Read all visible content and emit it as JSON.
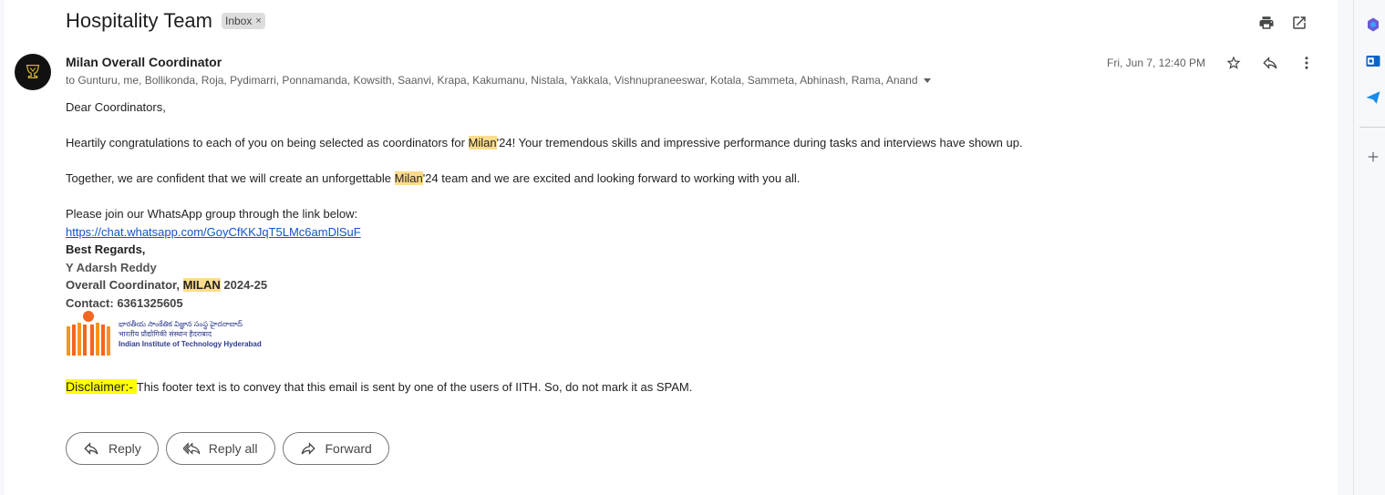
{
  "email": {
    "subject": "Hospitality Team",
    "label": "Inbox",
    "label_remove": "×",
    "sender": "Milan Overall Coordinator",
    "recipients": "to Gunturu, me, Bollikonda, Roja, Pydimarri, Ponnamanda, Kowsith, Saanvi, Krapa, Kakumanu, Nistala, Yakkala, Vishnupraneeswar, Kotala, Sammeta, Abhinash, Rama, Anand",
    "date": "Fri, Jun 7, 12:40 PM",
    "body": {
      "greeting": "Dear Coordinators,",
      "p1_pre": "Heartily congratulations to each of you on being selected as coordinators for ",
      "p1_hl": "Milan",
      "p1_post": "'24! Your tremendous skills and impressive performance during tasks and interviews have shown up.",
      "p2_pre": "Together, we are confident that we will create an unforgettable ",
      "p2_hl": "Milan",
      "p2_post": "'24 team and we are excited and looking forward to working with you all.",
      "p3": "Please join our WhatsApp group through the link below:",
      "link": "https://chat.whatsapp.com/GoyCfKKJqT5LMc6amDlSuF"
    },
    "signature": {
      "closing": "Best Regards,",
      "name": "Y Adarsh Reddy",
      "role_pre": "Overall Coordinator, ",
      "role_hl": "MILAN",
      "role_post": " 2024-25",
      "contact": "Contact: 6361325605",
      "logo_line1": "భారతీయ సాంకేతిక విజ్ఞాన సంస్థ హైదరాబాద్",
      "logo_line2": "भारतीय प्रौद्योगिकी संस्थान हैदराबाद",
      "logo_line3": "Indian Institute of Technology Hyderabad"
    },
    "disclaimer_label": "Disclaimer:- ",
    "disclaimer_text": "This footer text is to convey that this email is sent by one of the users of IITH. So, do not mark it as SPAM."
  },
  "actions": {
    "reply": "Reply",
    "reply_all": "Reply all",
    "forward": "Forward"
  },
  "colors": {
    "highlight": "#fddc8c",
    "disclaimer_highlight": "#ffff00",
    "link": "#1155cc",
    "logo_orange": "#f26522"
  },
  "icons": [
    "print-icon",
    "open-new-window-icon",
    "star-icon",
    "reply-icon",
    "more-vert-icon",
    "expand-caret-icon",
    "copilot-icon",
    "outlook-icon",
    "send-icon",
    "add-icon"
  ]
}
